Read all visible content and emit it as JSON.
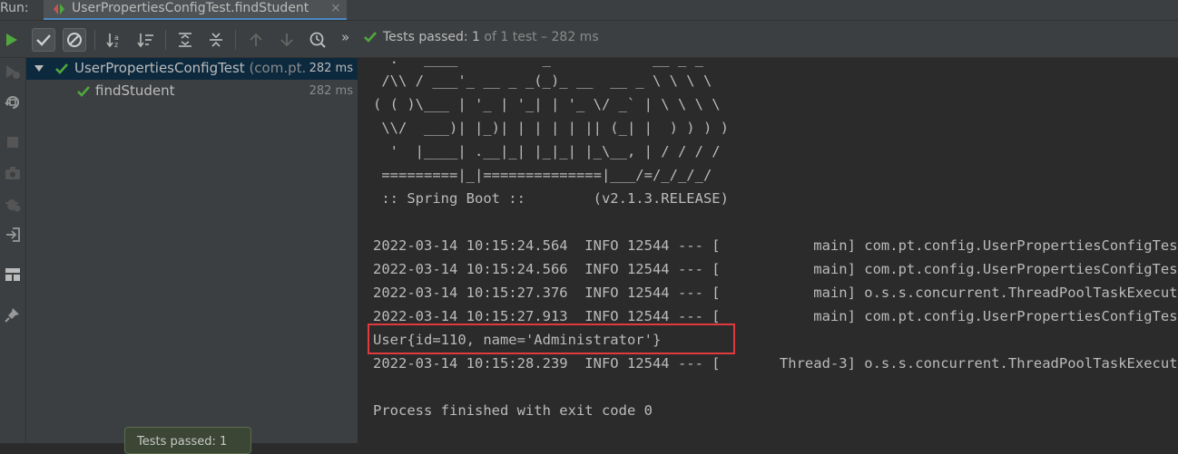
{
  "run_bar": {
    "label": "Run:",
    "tab_title": "UserPropertiesConfigTest.findStudent",
    "close_glyph": "×"
  },
  "toolbar": {
    "overflow": "»",
    "status_prefix": "Tests passed: ",
    "status_count": "1",
    "status_suffix": " of 1 test – 282 ms",
    "icons": [
      "run-icon",
      "show-passed-icon",
      "show-ignored-icon",
      "sort-alpha-icon",
      "sort-duration-icon",
      "expand-all-icon",
      "collapse-all-icon",
      "prev-failed-icon",
      "next-failed-icon",
      "test-history-icon"
    ]
  },
  "left_strip": {
    "icons": [
      "rerun-failed-icon",
      "toggle-autotest-icon",
      "stop-icon",
      "screenshot-icon",
      "debug-settings-icon",
      "exit-icon",
      "layout-icon",
      "pin-icon"
    ]
  },
  "tree": {
    "root": {
      "name": "UserPropertiesConfigTest",
      "pkg": "(com.pt.c",
      "time": "282 ms"
    },
    "child": {
      "name": "findStudent",
      "time": "282 ms"
    }
  },
  "popup": {
    "text": "Tests passed: 1"
  },
  "console": {
    "banner": [
      "  .   ____          _            __ _ _",
      " /\\\\ / ___'_ __ _ _(_)_ __  __ _ \\ \\ \\ \\",
      "( ( )\\___ | '_ | '_| | '_ \\/ _` | \\ \\ \\ \\",
      " \\\\/  ___)| |_)| | | | | || (_| |  ) ) ) )",
      "  '  |____| .__|_| |_|_| |_\\__, | / / / /",
      " =========|_|==============|___/=/_/_/_/",
      " :: Spring Boot ::        (v2.1.3.RELEASE)"
    ],
    "logs": [
      "2022-03-14 10:15:24.564  INFO 12544 --- [           main] com.pt.config.UserPropertiesConfigTest",
      "2022-03-14 10:15:24.566  INFO 12544 --- [           main] com.pt.config.UserPropertiesConfigTest",
      "2022-03-14 10:15:27.376  INFO 12544 --- [           main] o.s.s.concurrent.ThreadPoolTaskExecutor",
      "2022-03-14 10:15:27.913  INFO 12544 --- [           main] com.pt.config.UserPropertiesConfigTest",
      "User{id=110, name='Administrator'}",
      "2022-03-14 10:15:28.239  INFO 12544 --- [       Thread-3] o.s.s.concurrent.ThreadPoolTaskExecutor",
      "",
      "Process finished with exit code 0"
    ],
    "highlight_color": "#e0393e"
  },
  "colors": {
    "pass_green": "#4fa83d",
    "selection": "#0d293e",
    "panel": "#3c3f41",
    "editor_bg": "#2b2b2b"
  }
}
